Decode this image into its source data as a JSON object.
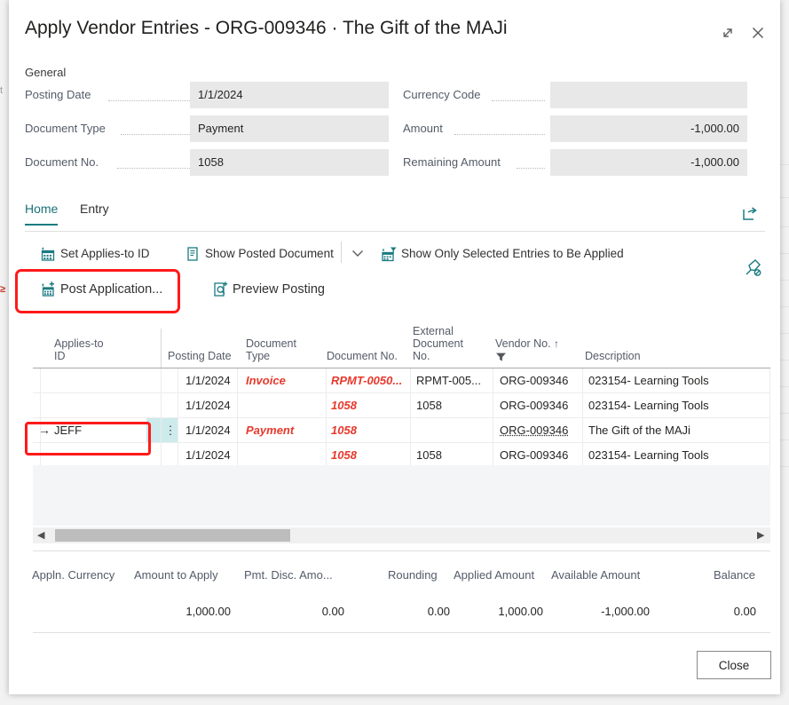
{
  "window": {
    "title": "Apply Vendor Entries - ORG-009346 · The Gift of the MAJi",
    "expand_icon": "expand-icon",
    "close_icon": "close-icon"
  },
  "general": {
    "section_label": "General",
    "left_fields": [
      {
        "label": "Posting Date",
        "value": "1/1/2024"
      },
      {
        "label": "Document Type",
        "value": "Payment"
      },
      {
        "label": "Document No.",
        "value": "1058"
      }
    ],
    "right_fields": [
      {
        "label": "Currency Code",
        "value": ""
      },
      {
        "label": "Amount",
        "value": "-1,000.00"
      },
      {
        "label": "Remaining Amount",
        "value": "-1,000.00"
      }
    ]
  },
  "ribbon": {
    "tabs": [
      {
        "label": "Home",
        "active": true
      },
      {
        "label": "Entry",
        "active": false
      }
    ],
    "row1": [
      {
        "label": "Set Applies-to ID",
        "icon": "calendar-applies-icon"
      },
      {
        "label": "Show Posted Document",
        "icon": "document-icon"
      },
      {
        "label": "Show Only Selected Entries to Be Applied",
        "icon": "filter-entries-icon"
      }
    ],
    "row2": [
      {
        "label": "Post Application...",
        "icon": "post-application-icon"
      },
      {
        "label": "Preview Posting",
        "icon": "preview-posting-icon"
      }
    ],
    "overflow_icon": "chevron-down-icon",
    "share_icon": "share-icon",
    "unpin_icon": "unpin-icon"
  },
  "grid": {
    "columns": [
      "Applies-to\nID",
      "Posting Date",
      "Document\nType",
      "Document No.",
      "External\nDocument\nNo.",
      "Vendor No.",
      "Description"
    ],
    "col_applies_to_id": "Applies-to",
    "col_applies_to_id2": "ID",
    "col_posting_date": "Posting Date",
    "col_document_type": "Document",
    "col_document_type2": "Type",
    "col_document_no": "Document No.",
    "col_ext_doc_no1": "External",
    "col_ext_doc_no2": "Document",
    "col_ext_doc_no3": "No.",
    "col_vendor_no": "Vendor No.",
    "col_vendor_sort": "↑",
    "col_description": "Description",
    "rows": [
      {
        "applies_to_id": "",
        "posting_date": "1/1/2024",
        "document_type": "Invoice",
        "document_no": "RPMT-0050...",
        "external_document_no": "RPMT-005...",
        "vendor_no": "ORG-009346",
        "description": "023154- Learning Tools",
        "selected": false
      },
      {
        "applies_to_id": "",
        "posting_date": "1/1/2024",
        "document_type": "",
        "document_no": "1058",
        "external_document_no": "1058",
        "vendor_no": "ORG-009346",
        "description": "023154- Learning Tools",
        "selected": false
      },
      {
        "applies_to_id": "JEFF",
        "posting_date": "1/1/2024",
        "document_type": "Payment",
        "document_no": "1058",
        "external_document_no": "",
        "vendor_no": "ORG-009346",
        "description": "The Gift of the MAJi",
        "selected": true
      },
      {
        "applies_to_id": "",
        "posting_date": "1/1/2024",
        "document_type": "",
        "document_no": "1058",
        "external_document_no": "1058",
        "vendor_no": "ORG-009346",
        "description": "023154- Learning Tools",
        "selected": false
      }
    ],
    "row_indicator": "→",
    "row_menu": "⋮",
    "scroll_left_icon": "◀",
    "scroll_right_icon": "▶"
  },
  "totals": {
    "headers": [
      "Appln. Currency",
      "Amount to Apply",
      "Pmt. Disc. Amo...",
      "Rounding",
      "Applied Amount",
      "Available Amount",
      "Balance"
    ],
    "values": [
      "",
      "1,000.00",
      "0.00",
      "0.00",
      "1,000.00",
      "-1,000.00",
      "0.00"
    ]
  },
  "footer": {
    "close_label": "Close"
  },
  "colors": {
    "accent": "#1b7b82",
    "highlight_red": "#ff1a1a",
    "grid_red": "#e8382c",
    "selection": "#cdeaec",
    "field_bg": "#e8e8e8"
  }
}
